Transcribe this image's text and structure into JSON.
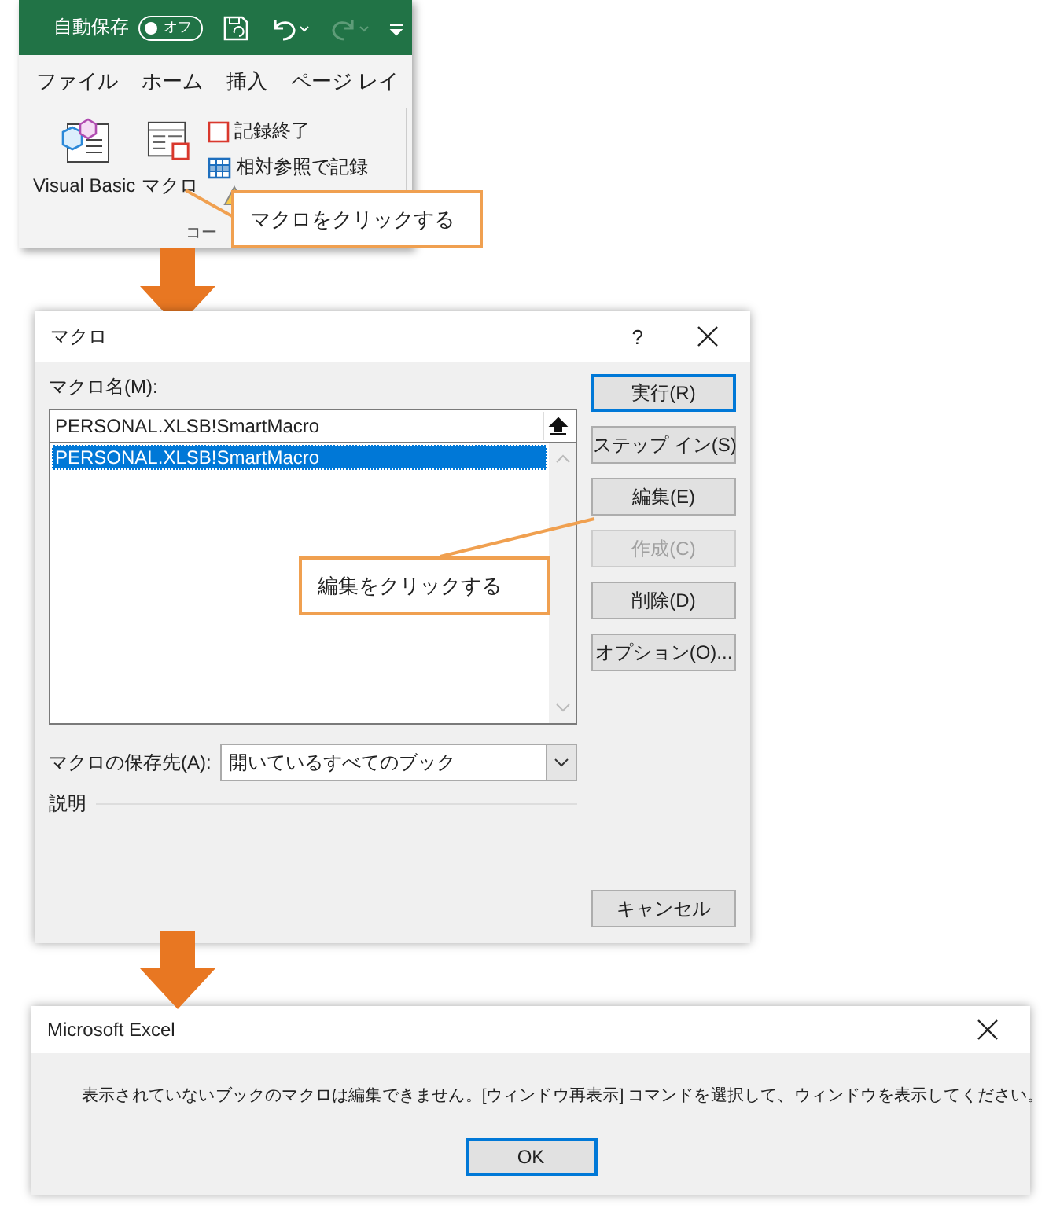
{
  "ribbon": {
    "autosave": {
      "label": "自動保存",
      "toggle_text": "オフ",
      "on": false
    },
    "tabs": [
      {
        "label": "ファイル"
      },
      {
        "label": "ホーム"
      },
      {
        "label": "挿入"
      },
      {
        "label": "ページ レイ"
      }
    ],
    "large_buttons": [
      {
        "label": "Visual Basic",
        "kind": "vb"
      },
      {
        "label": "マクロ",
        "kind": "macro"
      }
    ],
    "small_buttons": [
      {
        "label": "記録終了",
        "kind": "stop"
      },
      {
        "label": "相対参照で記録",
        "kind": "relative"
      }
    ],
    "group_label": "コー",
    "callout": "マクロをクリックする"
  },
  "macro_dialog": {
    "title": "マクロ",
    "help": "?",
    "name_label": "マクロ名(M):",
    "name_value": "PERSONAL.XLSB!SmartMacro",
    "macros": [
      {
        "name": "PERSONAL.XLSB!SmartMacro",
        "selected": true
      }
    ],
    "buttons": [
      {
        "label": "実行(R)",
        "default": true,
        "disabled": false
      },
      {
        "label": "ステップ イン(S)",
        "default": false,
        "disabled": false
      },
      {
        "label": "編集(E)",
        "default": false,
        "disabled": false
      },
      {
        "label": "作成(C)",
        "default": false,
        "disabled": true
      },
      {
        "label": "削除(D)",
        "default": false,
        "disabled": false
      },
      {
        "label": "オプション(O)...",
        "default": false,
        "disabled": false
      }
    ],
    "store_label": "マクロの保存先(A):",
    "store_value": "開いているすべてのブック",
    "description_label": "説明",
    "cancel": "キャンセル",
    "callout": "編集をクリックする"
  },
  "message_box": {
    "title": "Microsoft Excel",
    "message": "表示されていないブックのマクロは編集できません。[ウィンドウ再表示] コマンドを選択して、ウィンドウを表示してください。",
    "ok": "OK"
  }
}
